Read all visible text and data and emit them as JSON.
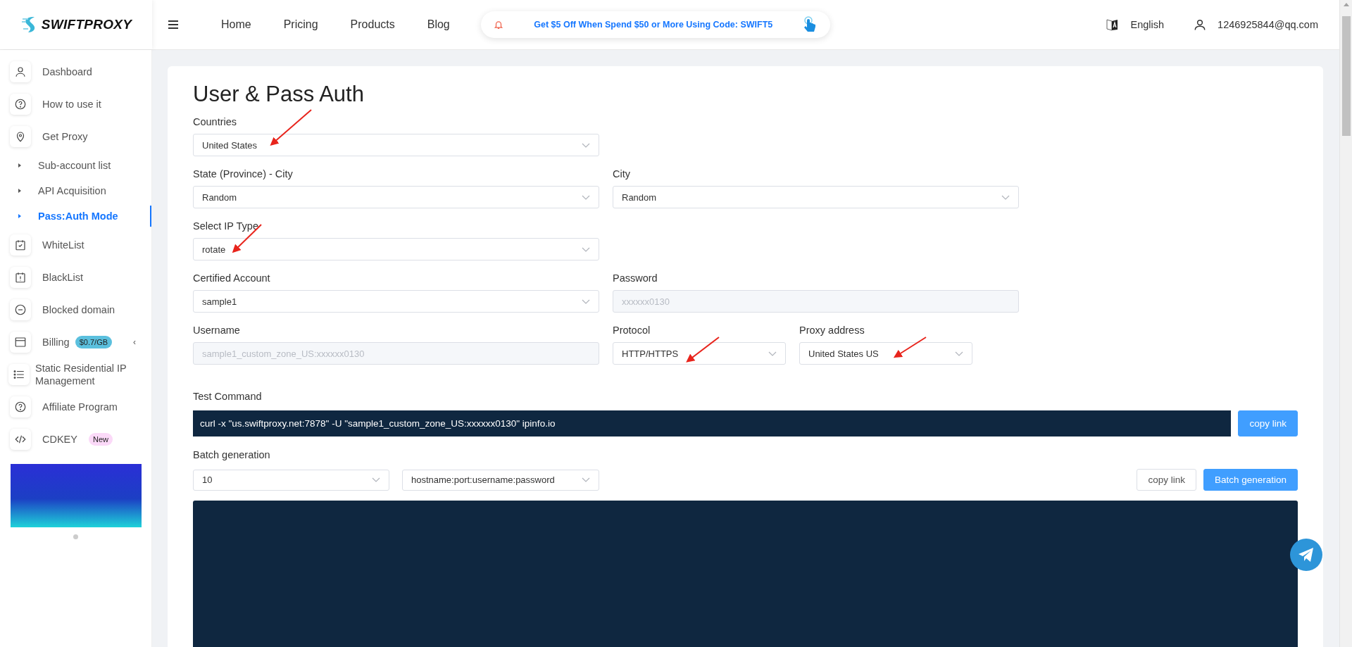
{
  "logo": {
    "text": "SWIFTPROXY"
  },
  "nav": {
    "links": [
      "Home",
      "Pricing",
      "Products",
      "Blog"
    ],
    "promo": "Get $5 Off When Spend $50 or More Using Code: SWIFT5",
    "language": "English",
    "account": "1246925844@qq.com"
  },
  "sidebar": {
    "items": [
      {
        "kind": "main",
        "label": "Dashboard",
        "selected": false
      },
      {
        "kind": "main",
        "label": "How to use it",
        "selected": false
      },
      {
        "kind": "main",
        "label": "Get Proxy",
        "selected": false
      },
      {
        "kind": "sub",
        "label": "Sub-account list",
        "selected": false
      },
      {
        "kind": "sub",
        "label": "API Acquisition",
        "selected": false
      },
      {
        "kind": "sub",
        "label": "Pass:Auth Mode",
        "selected": true
      },
      {
        "kind": "main",
        "label": "WhiteList",
        "selected": false
      },
      {
        "kind": "main",
        "label": "BlackList",
        "selected": false
      },
      {
        "kind": "main",
        "label": "Blocked domain",
        "selected": false
      },
      {
        "kind": "group",
        "label": "Billing",
        "selected": false,
        "badge": {
          "text": "$0.7/GB",
          "color": "#5bc0de"
        },
        "toggle": "‹"
      },
      {
        "kind": "main",
        "label": "Static Residential IP Management",
        "selected": false
      },
      {
        "kind": "main",
        "label": "Affiliate Program",
        "selected": false
      },
      {
        "kind": "main",
        "label": "CDKEY",
        "selected": false,
        "badge": {
          "text": "New",
          "color": "#fbd9f8"
        }
      }
    ]
  },
  "page": {
    "title": "User & Pass Auth",
    "rows": [
      [
        {
          "label": "Countries",
          "value": "United States",
          "kind": "select",
          "disabled": false
        }
      ],
      [
        {
          "label": "State (Province) - City",
          "value": "Random",
          "kind": "select",
          "disabled": false
        },
        {
          "label": "City",
          "value": "Random",
          "kind": "select",
          "disabled": false
        }
      ],
      [
        {
          "label": "Select IP Type",
          "value": "rotate",
          "kind": "select",
          "disabled": false
        }
      ],
      [
        {
          "label": "Certified Account",
          "value": "sample1",
          "kind": "select",
          "disabled": false
        },
        {
          "label": "Password",
          "value": "xxxxxx0130",
          "kind": "input",
          "disabled": true
        }
      ],
      [
        {
          "label": "Username",
          "value": "sample1_custom_zone_US:xxxxxx0130",
          "kind": "input",
          "disabled": true
        },
        {
          "label": "Protocol",
          "value": "HTTP/HTTPS",
          "kind": "select",
          "disabled": false
        },
        {
          "label": "Proxy address",
          "value": "United States US",
          "kind": "select",
          "disabled": false
        }
      ]
    ],
    "test_command": {
      "label": "Test Command",
      "command": "curl -x \"us.swiftproxy.net:7878\" -U \"sample1_custom_zone_US:xxxxxx0130\" ipinfo.io",
      "button": "copy link"
    },
    "batch": {
      "label": "Batch generation",
      "count": "10",
      "format": "hostname:port:username:password",
      "buttons": [
        {
          "label": "copy link",
          "kind": "secondary"
        },
        {
          "label": "Batch generation",
          "kind": "primary"
        }
      ]
    }
  }
}
